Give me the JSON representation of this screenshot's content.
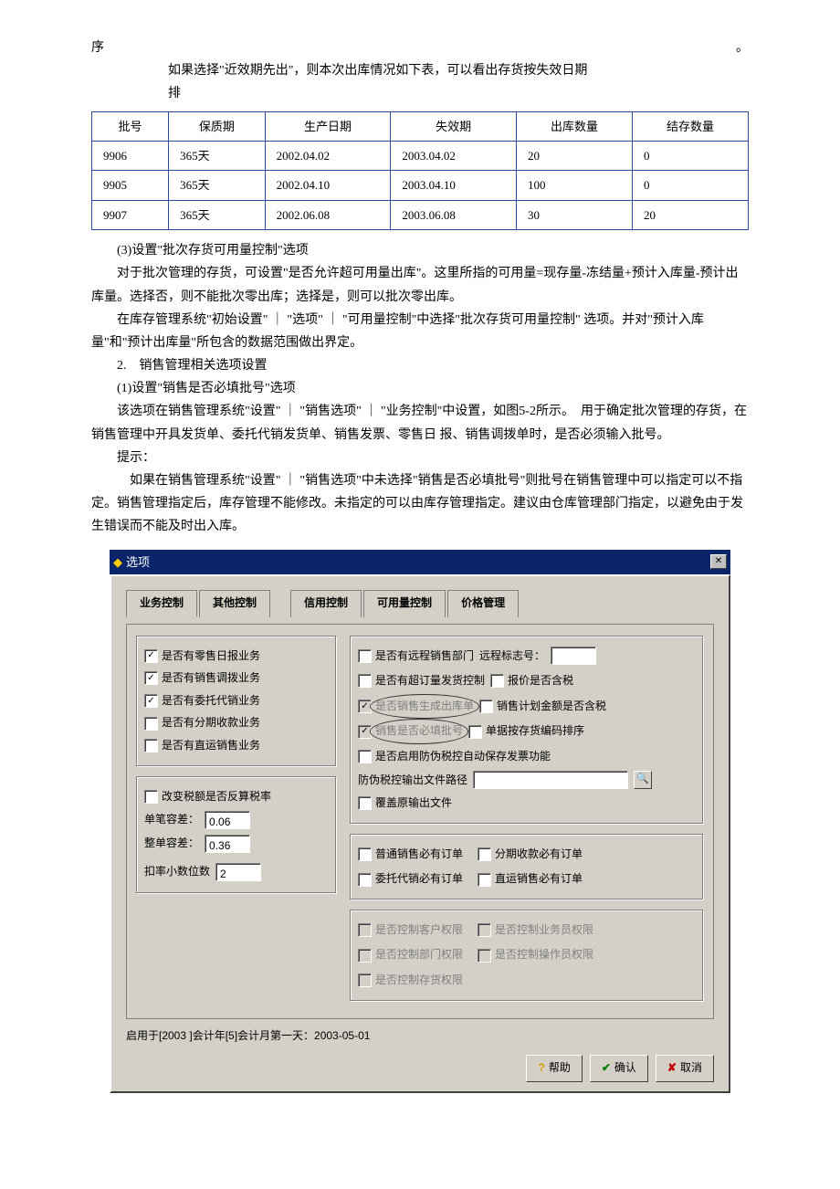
{
  "doc": {
    "l1": "序",
    "l1r": "。",
    "l2": "如果选择\"近效期先出\"，则本次出库情况如下表，可以看出存货按失效日期",
    "l3": "排",
    "table_headers": [
      "批号",
      "保质期",
      "生产日期",
      "失效期",
      "出库数量",
      "结存数量"
    ],
    "table_rows": [
      [
        "9906",
        "365天",
        "2002.04.02",
        "2003.04.02",
        "20",
        "0"
      ],
      [
        "9905",
        "365天",
        "2002.04.10",
        "2003.04.10",
        "100",
        "0"
      ],
      [
        "9907",
        "365天",
        "2002.06.08",
        "2003.06.08",
        "30",
        "20"
      ]
    ],
    "p1": "(3)设置\"批次存货可用量控制\"选项",
    "p2": "对于批次管理的存货，可设置\"是否允许超可用量出库\"。这里所指的可用量=现存量-冻结量+预计入库量-预计出库量。选择否，则不能批次零出库；选择是，则可以批次零出库。",
    "p3": "在库存管理系统\"初始设置\" ｜ \"选项\" ｜ \"可用量控制\"中选择\"批次存货可用量控制\" 选项。并对\"预计入库量\"和\"预计出库量\"所包含的数据范围做出界定。",
    "p4": "2.　销售管理相关选项设置",
    "p5": "(1)设置\"销售是否必填批号\"选项",
    "p6": "该选项在销售管理系统\"设置\" ｜ \"销售选项\" ｜ \"业务控制\"中设置，如图5-2所示。　用于确定批次管理的存货，在销售管理中开具发货单、委托代销发货单、销售发票、零售日 报、销售调拨单时，是否必须输入批号。",
    "p7": "提示：",
    "p8": "如果在销售管理系统\"设置\" ｜ \"销售选项\"中未选择\"销售是否必填批号\"则批号在销售管理中可以指定可以不指定。销售管理指定后，库存管理不能修改。未指定的可以由库存管理指定。建议由仓库管理部门指定，以避免由于发生错误而不能及时出入库。"
  },
  "dialog": {
    "title": "选项",
    "tabs": [
      "业务控制",
      "其他控制",
      "信用控制",
      "可用量控制",
      "价格管理"
    ],
    "left_checks": [
      {
        "label": "是否有零售日报业务",
        "checked": true
      },
      {
        "label": "是否有销售调拨业务",
        "checked": true
      },
      {
        "label": "是否有委托代销业务",
        "checked": true
      },
      {
        "label": "是否有分期收款业务",
        "checked": false
      },
      {
        "label": "是否有直运销售业务",
        "checked": false
      }
    ],
    "tax_recalc": "改变税额是否反算税率",
    "single_diff_label": "单笔容差：",
    "single_diff_value": "0.06",
    "whole_diff_label": "整单容差：",
    "whole_diff_value": "0.36",
    "rate_dec_label": "扣率小数位数",
    "rate_dec_value": "2",
    "right_checks_a": [
      {
        "label": "是否有远程销售部门",
        "extra_label": "远程标志号：",
        "extra_field": true
      },
      {
        "label": "是否有超订量发货控制",
        "extra_check": "报价是否含税"
      },
      {
        "label": "是否销售生成出库单",
        "checked": true,
        "disabled": true,
        "extra_check": "销售计划金额是否含税",
        "circled": true
      },
      {
        "label": "销售是否必填批号",
        "checked": true,
        "disabled": true,
        "extra_check": "单据按存货编码排序",
        "circled": true
      }
    ],
    "anti_tax_check": "是否启用防伪税控自动保存发票功能",
    "anti_tax_path_label": "防伪税控输出文件路径",
    "overwrite_check": "覆盖原输出文件",
    "right_checks_b": [
      {
        "l": "普通销售必有订单",
        "r": "分期收款必有订单"
      },
      {
        "l": "委托代销必有订单",
        "r": "直运销售必有订单"
      }
    ],
    "right_checks_c": [
      {
        "l": "是否控制客户权限",
        "r": "是否控制业务员权限"
      },
      {
        "l": "是否控制部门权限",
        "r": "是否控制操作员权限"
      },
      {
        "l": "是否控制存货权限",
        "r": ""
      }
    ],
    "bottom_line": "启用于[2003 ]会计年[5]会计月第一天：2003-05-01",
    "buttons": {
      "help": "帮助",
      "ok": "确认",
      "cancel": "取消"
    }
  }
}
